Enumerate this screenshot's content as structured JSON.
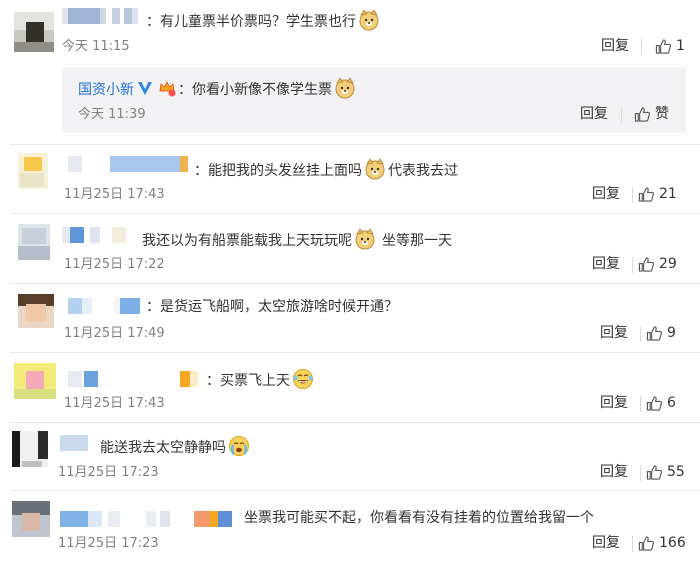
{
  "colors": {
    "link": "#1f6fd1",
    "muted": "#808080",
    "box": "#f2f2f5"
  },
  "main_comment": {
    "text": "：有儿童票半价票吗？学生票也行",
    "time": "今天 11:15",
    "reply": "回复",
    "likes": "1",
    "emoji": "doge-emoji"
  },
  "sub_reply": {
    "user": "国资小新",
    "verified_icon": "blue-v-icon",
    "badge_icon": "vip-crown-icon",
    "text": "：你看小新像不像学生票",
    "time": "今天 11:39",
    "reply": "回复",
    "like": "赞"
  },
  "comments": [
    {
      "text_a": "：能把我的头发丝挂上面吗",
      "text_b": "代表我去过",
      "time": "11月25日 17:43",
      "reply": "回复",
      "likes": "21"
    },
    {
      "text_a": "我还以为有船票能载我上天玩玩呢",
      "text_b": "坐等那一天",
      "time": "11月25日 17:22",
      "reply": "回复",
      "likes": "29"
    },
    {
      "text_a": "：是货运飞船啊，太空旅游啥时候开通？",
      "time": "11月25日 17:49",
      "reply": "回复",
      "likes": "9"
    },
    {
      "text_a": "：买票飞上天",
      "time": "11月25日 17:43",
      "reply": "回复",
      "likes": "6"
    },
    {
      "text_a": "能送我去太空静静吗",
      "time": "11月25日 17:23",
      "reply": "回复",
      "likes": "55"
    },
    {
      "text_a": "坐票我可能买不起，你看看有没有挂着的位置给我留一个",
      "time": "11月25日 17:23",
      "reply": "回复",
      "likes": "166"
    }
  ]
}
